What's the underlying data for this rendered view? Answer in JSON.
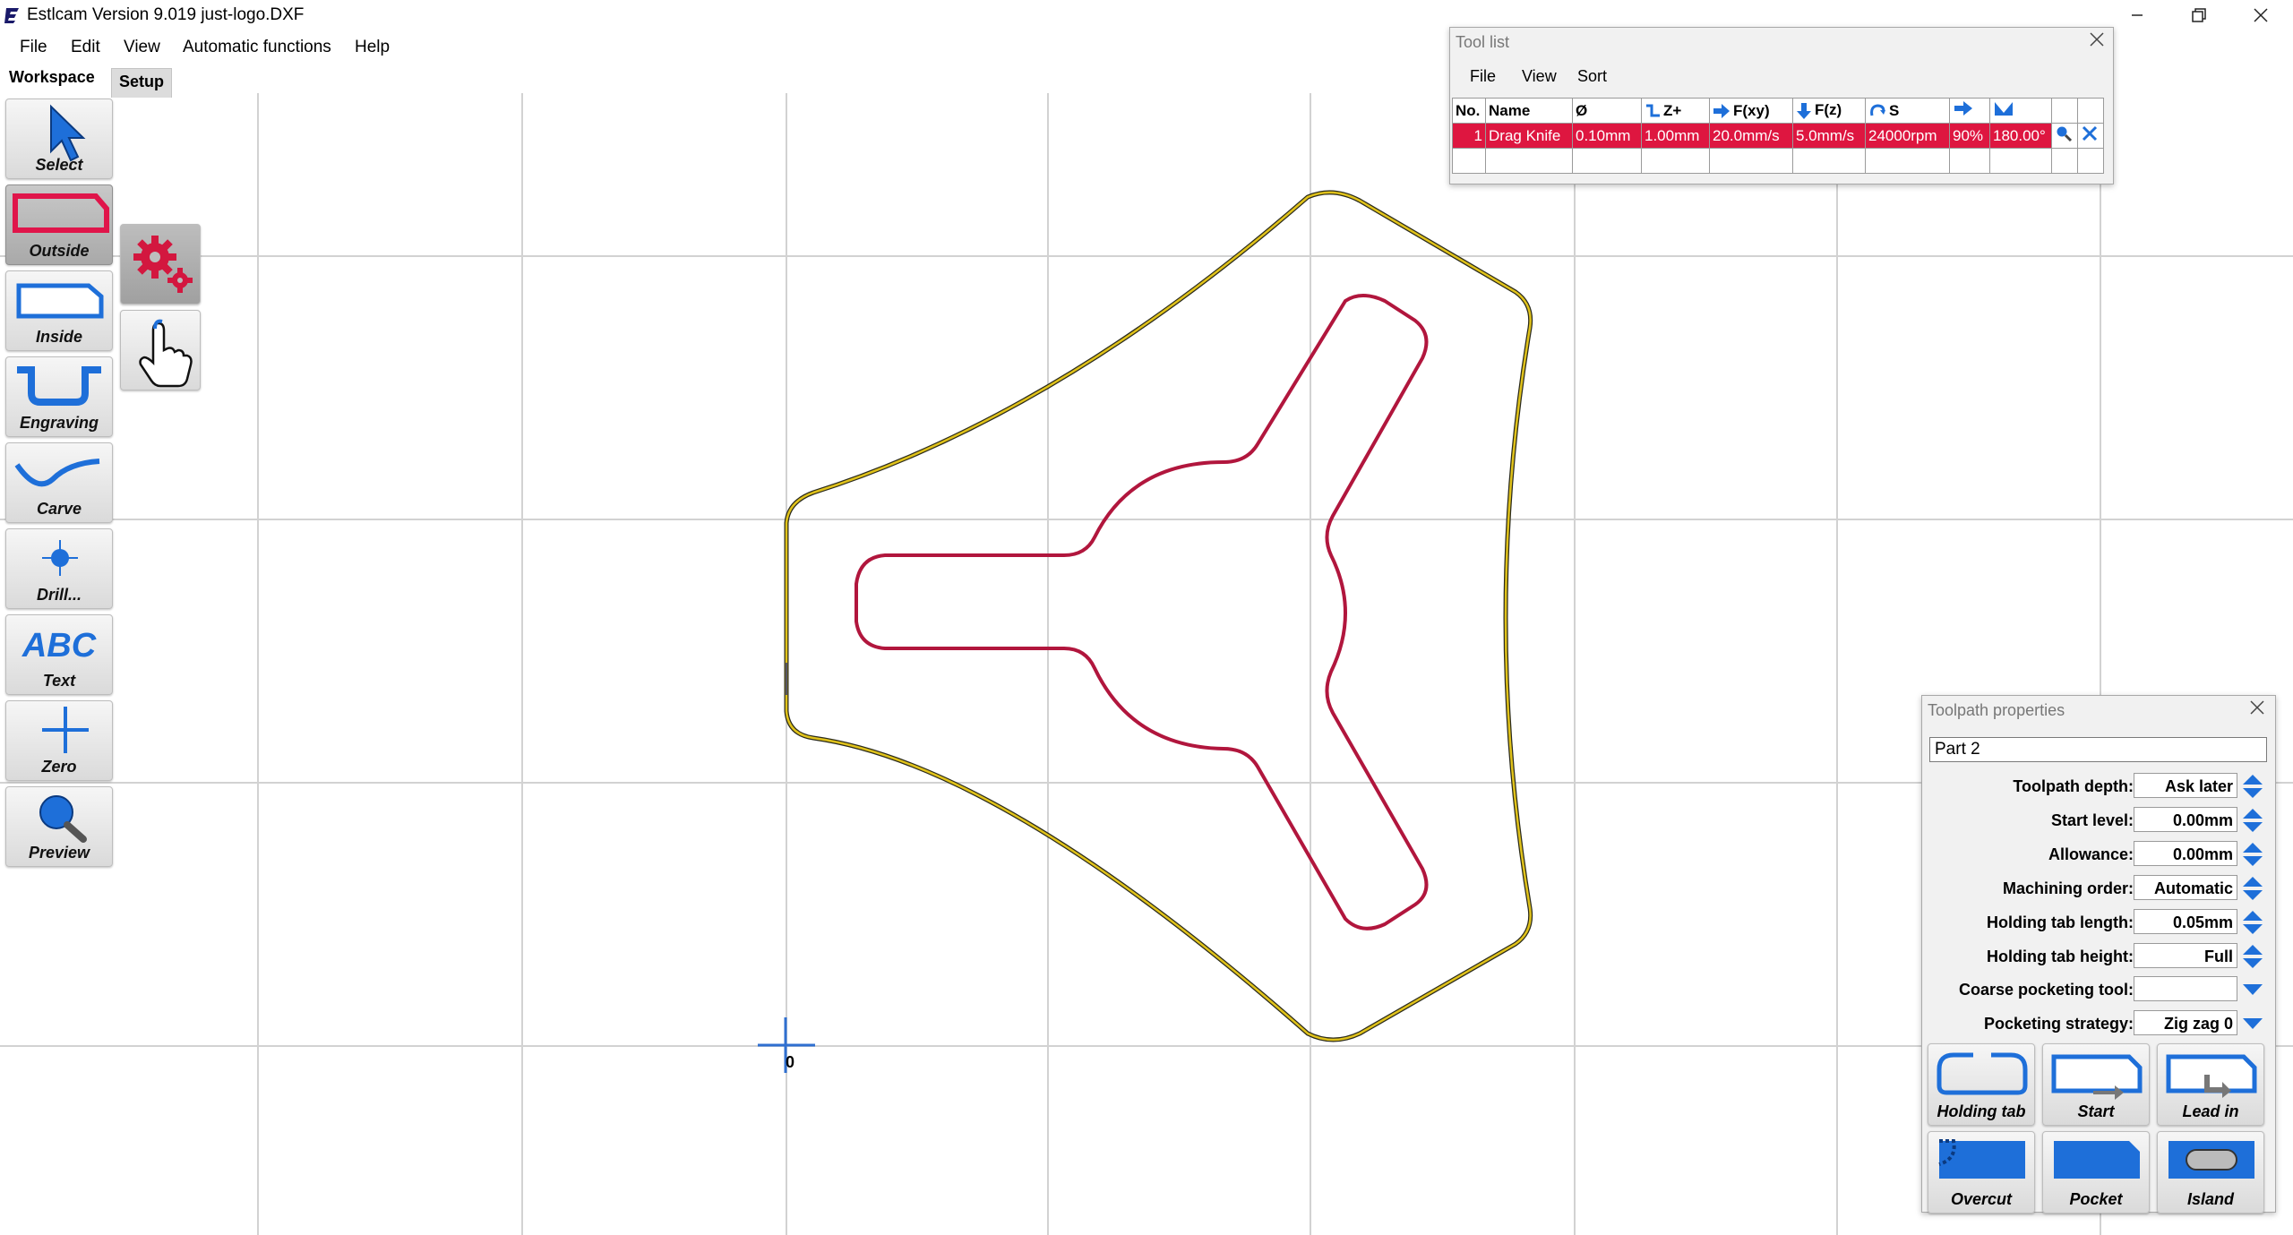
{
  "titlebar": {
    "title": "Estlcam Version 9.019 just-logo.DXF"
  },
  "menu": {
    "file": "File",
    "edit": "Edit",
    "view": "View",
    "automatic": "Automatic functions",
    "help": "Help"
  },
  "tabs": {
    "workspace": "Workspace",
    "setup": "Setup"
  },
  "left_toolbar": {
    "select": "Select",
    "outside": "Outside",
    "inside": "Inside",
    "engraving": "Engraving",
    "carve": "Carve",
    "drill": "Drill...",
    "text": "Text",
    "text_icon": "ABC",
    "zero": "Zero",
    "preview": "Preview"
  },
  "canvas": {
    "origin_label": "0"
  },
  "tool_list": {
    "title": "Tool list",
    "menu": {
      "file": "File",
      "view": "View",
      "sort": "Sort"
    },
    "headers": {
      "no": "No.",
      "name": "Name",
      "diameter": "Ø",
      "z_plus": "Z+",
      "fxy": "F(xy)",
      "fz": "F(z)",
      "s": "S"
    },
    "rows": [
      {
        "no": "1",
        "name": "Drag Knife",
        "diameter": "0.10mm",
        "z_plus": "1.00mm",
        "fxy": "20.0mm/s",
        "fz": "5.0mm/s",
        "s": "24000rpm",
        "stepover": "90%",
        "angle": "180.00°"
      }
    ]
  },
  "toolpath_properties": {
    "title": "Toolpath properties",
    "part_name": "Part 2",
    "rows": [
      {
        "label": "Toolpath depth:",
        "value": "Ask later"
      },
      {
        "label": "Start level:",
        "value": "0.00mm"
      },
      {
        "label": "Allowance:",
        "value": "0.00mm"
      },
      {
        "label": "Machining order:",
        "value": "Automatic"
      },
      {
        "label": "Holding tab length:",
        "value": "0.05mm"
      },
      {
        "label": "Holding tab height:",
        "value": "Full"
      },
      {
        "label": "Coarse pocketing tool:",
        "value": ""
      },
      {
        "label": "Pocketing strategy:",
        "value": "Zig zag 0"
      }
    ],
    "buttons": {
      "holding_tab": "Holding tab",
      "start": "Start",
      "lead_in": "Lead in",
      "overcut": "Overcut",
      "pocket": "Pocket",
      "island": "Island"
    }
  },
  "colors": {
    "accent_blue": "#1e6fd9",
    "outside_path": "#e0c21a",
    "inside_path": "#b1163d",
    "selected_row": "#de1640",
    "grid": "#d2d2d2"
  }
}
